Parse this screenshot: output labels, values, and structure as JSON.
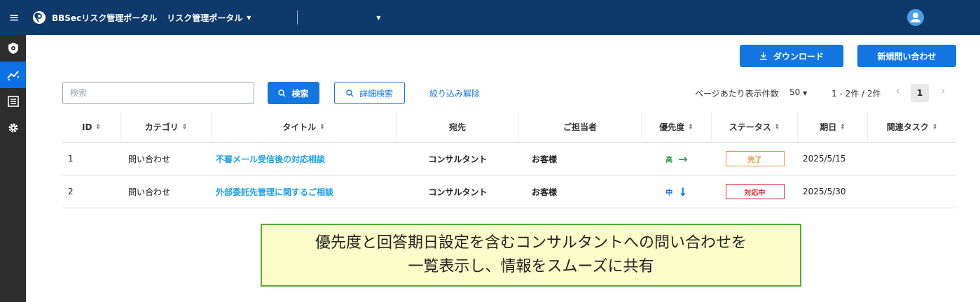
{
  "header": {
    "app_title": "BBSecリスク管理ポータル",
    "portal_select": "リスク管理ポータル",
    "icons": {
      "menu": "hamburger-icon",
      "logo": "bbsec-logo",
      "user": "user-avatar-icon"
    }
  },
  "sidebar": {
    "items": [
      {
        "icon": "shield-icon",
        "active": false
      },
      {
        "icon": "chart-line-icon",
        "active": true
      },
      {
        "icon": "list-icon",
        "active": false
      },
      {
        "icon": "gear-icon",
        "active": false
      }
    ]
  },
  "toolbar": {
    "download_label": "ダウンロード",
    "new_inquiry_label": "新規問い合わせ",
    "search_placeholder": "検索",
    "search_value": "",
    "search_button": "検索",
    "advanced_search_button": "詳細検索",
    "clear_filter_link": "絞り込み解除"
  },
  "pagination": {
    "per_page_label": "ページあたり表示件数",
    "per_page_value": "50",
    "range_text": "1 - 2件 / 2件",
    "current_page": "1"
  },
  "table": {
    "columns": [
      "ID",
      "カテゴリ",
      "タイトル",
      "宛先",
      "ご担当者",
      "優先度",
      "ステータス",
      "期日",
      "関連タスク"
    ],
    "rows": [
      {
        "id": "1",
        "category": "問い合わせ",
        "title": "不審メール受信後の対応相談",
        "to": "コンサルタント",
        "owner": "お客様",
        "priority": "高",
        "priority_arrow": "→",
        "priority_color": "#2e9e4a",
        "status": "完了",
        "status_color": "#f08c2e",
        "due": "2025/5/15",
        "task": ""
      },
      {
        "id": "2",
        "category": "問い合わせ",
        "title": "外部委託先管理に関するご相談",
        "to": "コンサルタント",
        "owner": "お客様",
        "priority": "中",
        "priority_arrow": "↓",
        "priority_color": "#1476e0",
        "status": "対応中",
        "status_color": "#e0283a",
        "due": "2025/5/30",
        "task": ""
      }
    ]
  },
  "callout": {
    "line1": "優先度と回答期日設定を含むコンサルタントへの問い合わせを",
    "line2": "一覧表示し、情報をスムーズに共有"
  },
  "colors": {
    "header_bg": "#0d3a6b",
    "sidebar_bg": "#2d2d2d",
    "accent": "#1476e0",
    "link": "#1ba0e0",
    "callout_bg": "#fcfcc8",
    "callout_border": "#5aa832"
  }
}
